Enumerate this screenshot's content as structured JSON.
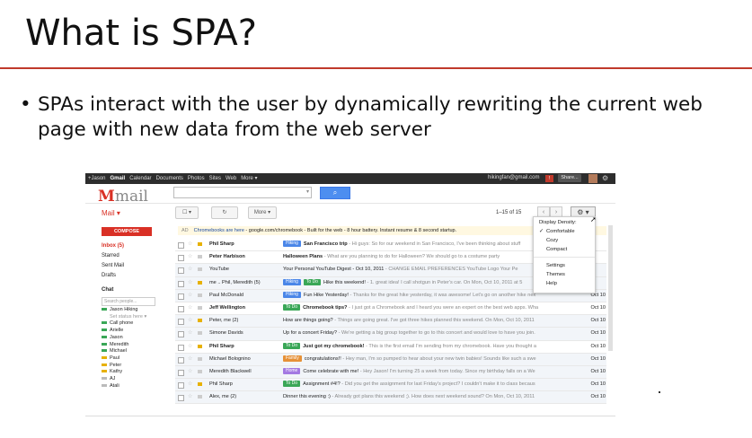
{
  "slide": {
    "title": "What is SPA?",
    "bullet": "SPAs interact with the user by dynamically rewriting the current web page with new data from the web server"
  },
  "gmail": {
    "topbar_links": [
      "+Jason",
      "Gmail",
      "Calendar",
      "Documents",
      "Photos",
      "Sites",
      "Web",
      "More ▾"
    ],
    "account": "hikingfan@gmail.com",
    "share_label": "Share...",
    "logo_text": "Gmail",
    "mail_menu": "Mail ▾",
    "refresh_icon": "↻",
    "more_label": "More ▾",
    "page_info": "1–15 of 15",
    "prev": "‹",
    "next": "›",
    "compose": "COMPOSE",
    "nav": [
      "Inbox (5)",
      "Starred",
      "Sent Mail",
      "Drafts"
    ],
    "chat_title": "Chat",
    "chat_search_placeholder": "Search people...",
    "contacts": [
      {
        "name": "Jason Hiking",
        "color": "#3aa757"
      },
      {
        "name": "Set status here ▾",
        "sub": true
      },
      {
        "name": "Call phone",
        "color": "#3aa757"
      },
      {
        "name": "Arielle",
        "color": "#3aa757"
      },
      {
        "name": "Jason",
        "color": "#3aa757"
      },
      {
        "name": "Meredith",
        "color": "#3aa757"
      },
      {
        "name": "Michael",
        "color": "#3aa757"
      },
      {
        "name": "Paul",
        "color": "#e7b100"
      },
      {
        "name": "Peter",
        "color": "#e7b100"
      },
      {
        "name": "Kathy",
        "color": "#e7b100"
      },
      {
        "name": "AJ",
        "color": "#bbbbbb"
      },
      {
        "name": "Atali",
        "color": "#bbbbbb"
      }
    ],
    "ad_tag": "AD",
    "ad_link": "Chromebooks are here",
    "ad_text": " - google.com/chromebook - Built for the web - 8 hour battery. Instant resume & 8 second startup.",
    "emails": [
      {
        "sender": "Phil Sharp",
        "label": "Hiking",
        "label_color": "#4a86e8",
        "subject": "San Francisco trip",
        "snippet": " - Hi guys: So for our weekend in San Francisco, I've been thinking about stuff",
        "date": "",
        "unread": true,
        "important": true
      },
      {
        "sender": "Peter Harbison",
        "subject": "Halloween Plans",
        "snippet": " - What are you planning to do for Halloween? We should go to a costume party",
        "date": "",
        "unread": true,
        "important": false
      },
      {
        "sender": "YouTube",
        "subject": "Your Personal YouTube Digest - Oct 10, 2011",
        "snippet": " - CHANGE EMAIL PREFERENCES YouTube Logo Your Pe",
        "date": "",
        "unread": false,
        "important": false
      },
      {
        "sender": "me .. Phil, Meredith (5)",
        "label": "Hiking",
        "label_color": "#4a86e8",
        "label2": "To Do",
        "label2_color": "#3aa757",
        "subject": "Hike this weekend!",
        "snippet": " - 1. great idea! I call shotgun in Peter's car. On Mon, Oct 10, 2011 at 5",
        "date": "",
        "unread": false,
        "important": true
      },
      {
        "sender": "Paul McDonald",
        "label": "Hiking",
        "label_color": "#4a86e8",
        "subject": "Fun Hike Yesterday!",
        "snippet": " - Thanks for the great hike yesterday, it was awesome! Let's go on another hike nex",
        "date": "Oct 10",
        "unread": false,
        "important": false
      },
      {
        "sender": "Jeff Wellington",
        "label": "To Do",
        "label_color": "#3aa757",
        "subject": "Chromebook tips?",
        "snippet": " - I just got a Chromebook and I heard you were an expert on the best web apps. Wha",
        "date": "Oct 10",
        "unread": true,
        "important": false
      },
      {
        "sender": "Peter, me (2)",
        "subject": "How are things going?",
        "snippet": " - Things are going great. I've got three hikes planned this weekend. On Mon, Oct 10, 2011",
        "date": "Oct 10",
        "unread": false,
        "important": true
      },
      {
        "sender": "Simone Davids",
        "subject": "Up for a concert Friday?",
        "snippet": " - We're getting a big group together to go to this concert and would love to have you join.",
        "date": "Oct 10",
        "unread": false,
        "important": false
      },
      {
        "sender": "Phil Sharp",
        "label": "To Do",
        "label_color": "#3aa757",
        "subject": "Just got my chromebook!",
        "snippet": " - This is the first email I'm sending from my chromebook. Have you thought a",
        "date": "Oct 10",
        "unread": true,
        "important": true
      },
      {
        "sender": "Michael Bolognino",
        "label": "Family",
        "label_color": "#e69138",
        "subject": "congratulations!!",
        "snippet": " - Hey man, I'm so pumped to hear about your new twin babies! Sounds like such a swe",
        "date": "Oct 10",
        "unread": false,
        "important": false
      },
      {
        "sender": "Meredith Blackwell",
        "label": "Home",
        "label_color": "#a479e2",
        "subject": "Come celebrate with me!",
        "snippet": " - Hey Jason! I'm turning 25 a week from today. Since my birthday falls on a We",
        "date": "Oct 10",
        "unread": false,
        "important": false
      },
      {
        "sender": "Phil Sharp",
        "label": "To Do",
        "label_color": "#3aa757",
        "subject": "Assignment #4!?",
        "snippet": " - Did you get the assignment for last Friday's project? I couldn't make it to class becaus",
        "date": "Oct 10",
        "unread": false,
        "important": true
      },
      {
        "sender": "Alex, me (2)",
        "subject": "Dinner this evening :)",
        "snippet": " - Already got plans this weekend ;). How does next weekend sound? On Mon, Oct 10, 2011",
        "date": "Oct 10",
        "unread": false,
        "important": false
      }
    ],
    "settings_menu": {
      "header": "Display Density:",
      "check": "✓",
      "options": [
        "Comfortable",
        "Cozy",
        "Compact"
      ],
      "items": [
        "Settings",
        "Themes",
        "Help"
      ]
    }
  }
}
